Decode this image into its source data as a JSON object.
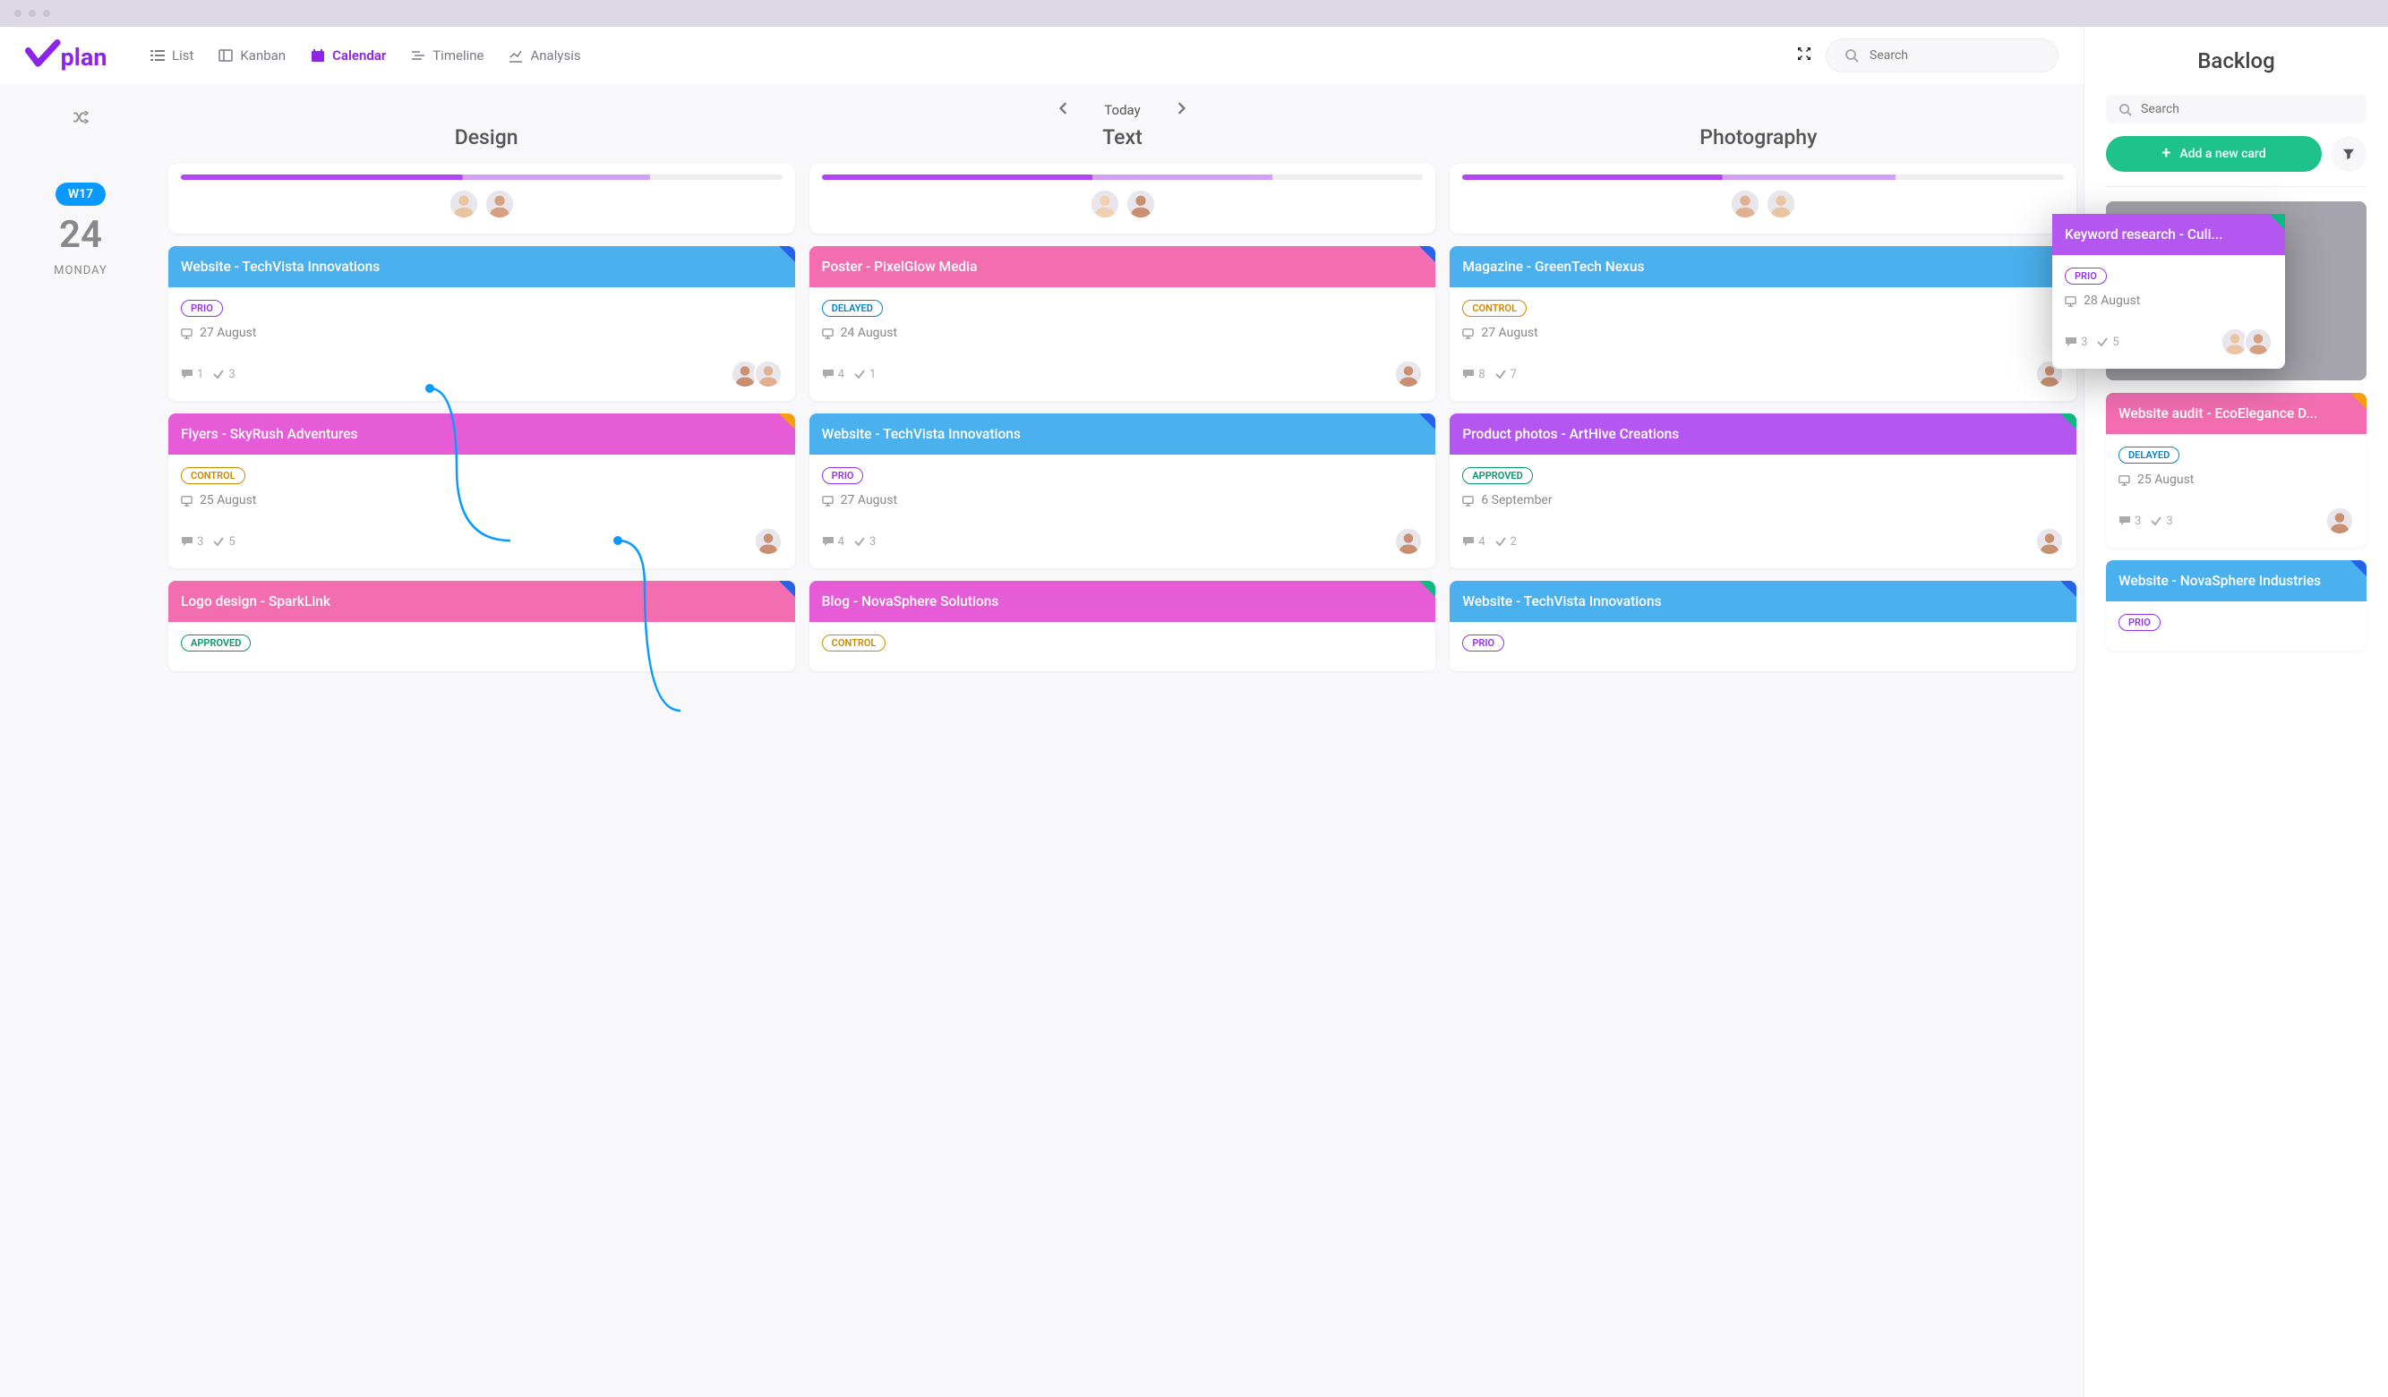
{
  "app_name": "vplan",
  "nav": {
    "list": "List",
    "kanban": "Kanban",
    "calendar": "Calendar",
    "timeline": "Timeline",
    "analysis": "Analysis"
  },
  "search": {
    "placeholder": "Search"
  },
  "date_nav": {
    "today": "Today"
  },
  "date_gutter": {
    "week": "W17",
    "day_num": "24",
    "day_name": "MONDAY"
  },
  "columns": [
    {
      "title": "Design",
      "progress": 78,
      "cards": [
        {
          "title": "Website - TechVista Innovations",
          "header_color": "blue",
          "corner": "blue",
          "tag": "PRIO",
          "tag_class": "prio",
          "date": "27 August",
          "comments": "1",
          "checks": "3",
          "avatars": 2
        },
        {
          "title": "Flyers - SkyRush Adventures",
          "header_color": "magenta",
          "corner": "orange",
          "tag": "CONTROL",
          "tag_class": "control",
          "date": "25 August",
          "comments": "3",
          "checks": "5",
          "avatars": 1
        },
        {
          "title": "Logo design - SparkLink",
          "header_color": "pink",
          "corner": "blue",
          "tag": "APPROVED",
          "tag_class": "approved",
          "date": "",
          "comments": "",
          "checks": "",
          "avatars": 0
        }
      ]
    },
    {
      "title": "Text",
      "progress": 75,
      "cards": [
        {
          "title": "Poster - PixelGlow Media",
          "header_color": "pink",
          "corner": "blue",
          "tag": "DELAYED",
          "tag_class": "delayed",
          "date": "24 August",
          "comments": "4",
          "checks": "1",
          "avatars": 1
        },
        {
          "title": "Website - TechVista Innovations",
          "header_color": "blue",
          "corner": "blue",
          "tag": "PRIO",
          "tag_class": "prio",
          "date": "27 August",
          "comments": "4",
          "checks": "3",
          "avatars": 1
        },
        {
          "title": "Blog - NovaSphere Solutions",
          "header_color": "magenta",
          "corner": "green",
          "tag": "CONTROL",
          "tag_class": "control",
          "date": "",
          "comments": "",
          "checks": "",
          "avatars": 0
        }
      ]
    },
    {
      "title": "Photography",
      "progress": 72,
      "cards": [
        {
          "title": "Magazine - GreenTech Nexus",
          "header_color": "blue",
          "corner": "orange",
          "tag": "CONTROL",
          "tag_class": "control",
          "date": "27 August",
          "comments": "8",
          "checks": "7",
          "avatars": 1
        },
        {
          "title": "Product photos - ArtHive Creations",
          "header_color": "purple",
          "corner": "green",
          "tag": "APPROVED",
          "tag_class": "approved",
          "date": "6 September",
          "comments": "4",
          "checks": "2",
          "avatars": 1
        },
        {
          "title": "Website - TechVista Innovations",
          "header_color": "blue",
          "corner": "blue",
          "tag": "PRIO",
          "tag_class": "prio",
          "date": "",
          "comments": "",
          "checks": "",
          "avatars": 0
        }
      ]
    }
  ],
  "sidebar": {
    "title": "Backlog",
    "search_placeholder": "Search",
    "add_btn": "Add a new card",
    "drag_card": {
      "title": "Keyword research - Culi...",
      "tag": "PRIO",
      "tag_class": "prio",
      "date": "28 August",
      "comments": "3",
      "checks": "5",
      "avatars": 2
    },
    "cards": [
      {
        "title": "Website audit -  EcoElegance D...",
        "header_color": "pink",
        "corner": "orange",
        "tag": "DELAYED",
        "tag_class": "delayed",
        "date": "25 August",
        "comments": "3",
        "checks": "3",
        "avatars": 1
      },
      {
        "title": "Website - NovaSphere Industries",
        "header_color": "blue",
        "corner": "blue",
        "tag": "PRIO",
        "tag_class": "prio",
        "date": "",
        "comments": "",
        "checks": "",
        "avatars": 0
      }
    ]
  }
}
